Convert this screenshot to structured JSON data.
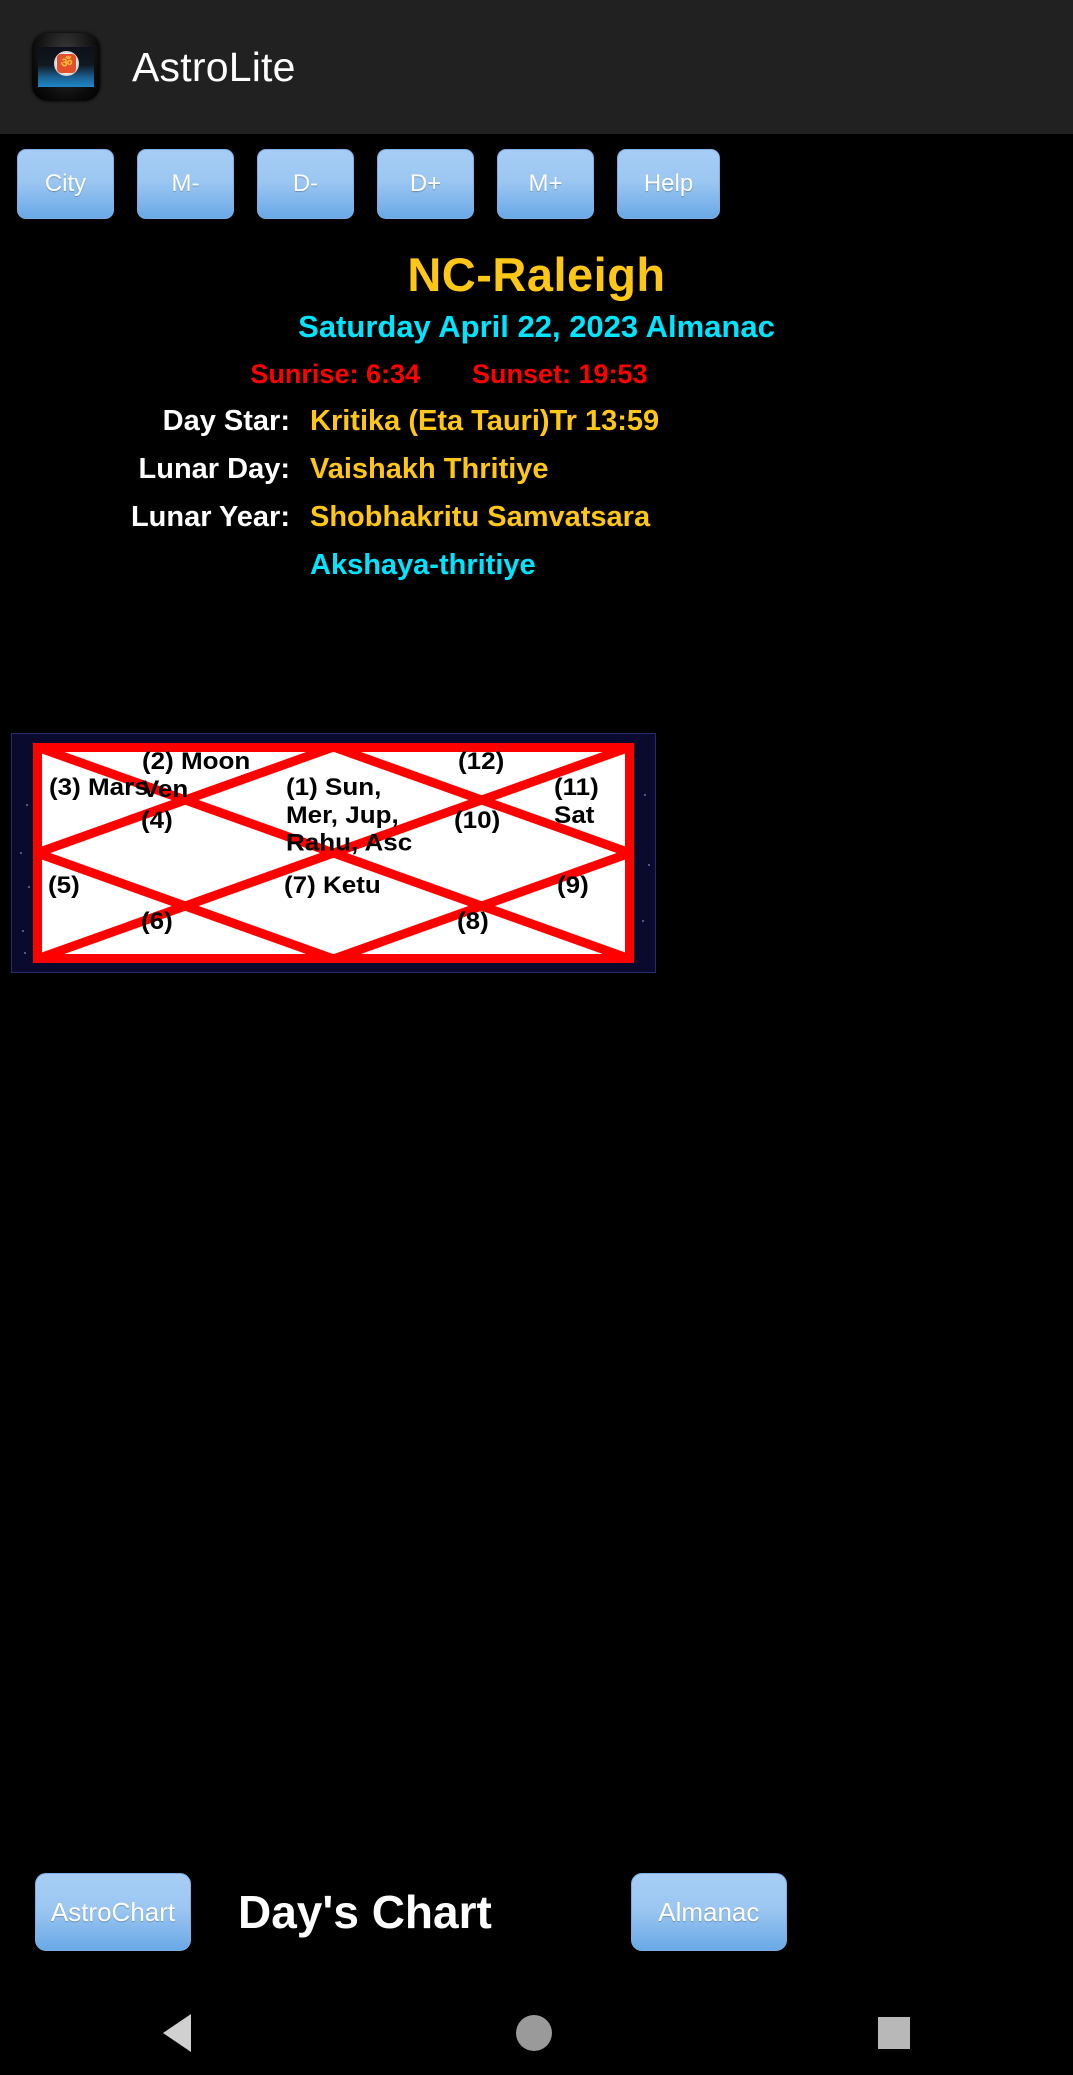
{
  "titlebar": {
    "app_name": "AstroLite",
    "icon_glyph": "ॐ"
  },
  "toolbar": {
    "buttons": [
      {
        "label": "City",
        "name": "city-button"
      },
      {
        "label": "M-",
        "name": "month-minus-button"
      },
      {
        "label": "D-",
        "name": "day-minus-button"
      },
      {
        "label": "D+",
        "name": "day-plus-button"
      },
      {
        "label": "M+",
        "name": "month-plus-button"
      },
      {
        "label": "Help",
        "name": "help-button"
      }
    ]
  },
  "info": {
    "city": "NC-Raleigh",
    "almanac_date": "Saturday April 22, 2023 Almanac",
    "sunrise": "Sunrise: 6:34",
    "sunset": "Sunset: 19:53",
    "rows": [
      {
        "key": "Day Star:",
        "value": "Kritika (Eta Tauri)Tr 13:59"
      },
      {
        "key": "Lunar Day:",
        "value": "Vaishakh Thritiye"
      },
      {
        "key": "Lunar Year:",
        "value": "Shobhakritu Samvatsara"
      }
    ],
    "festival": "Akshaya-thritiye"
  },
  "chart": {
    "houses": [
      {
        "id": 1,
        "label": "(1) Sun,\nMer, Jup,\nRahu, Asc"
      },
      {
        "id": 2,
        "label": "(2) Moon\nVen"
      },
      {
        "id": 3,
        "label": "(3) Mars"
      },
      {
        "id": 4,
        "label": "(4)"
      },
      {
        "id": 5,
        "label": "(5)"
      },
      {
        "id": 6,
        "label": "(6)"
      },
      {
        "id": 7,
        "label": "(7) Ketu"
      },
      {
        "id": 8,
        "label": "(8)"
      },
      {
        "id": 9,
        "label": "(9)"
      },
      {
        "id": 10,
        "label": "(10)"
      },
      {
        "id": 11,
        "label": "(11) Sat"
      },
      {
        "id": 12,
        "label": "(12)"
      }
    ],
    "line_color": "#FF0000",
    "background": "#FFFFFF",
    "border_color": "#0a0a2e"
  },
  "bottombar": {
    "astrochart_label": "AstroChart",
    "title": "Day's Chart",
    "almanac_label": "Almanac"
  },
  "navbar": {
    "back": "back-triangle",
    "home": "home-circle",
    "recent": "recents-square"
  },
  "colors": {
    "city": "#FFC715",
    "date": "#00E5FF",
    "sun": "#FF0000",
    "key": "#FFFFFF",
    "value": "#FFC715",
    "button": "#9cc7f2",
    "background": "#000000"
  }
}
